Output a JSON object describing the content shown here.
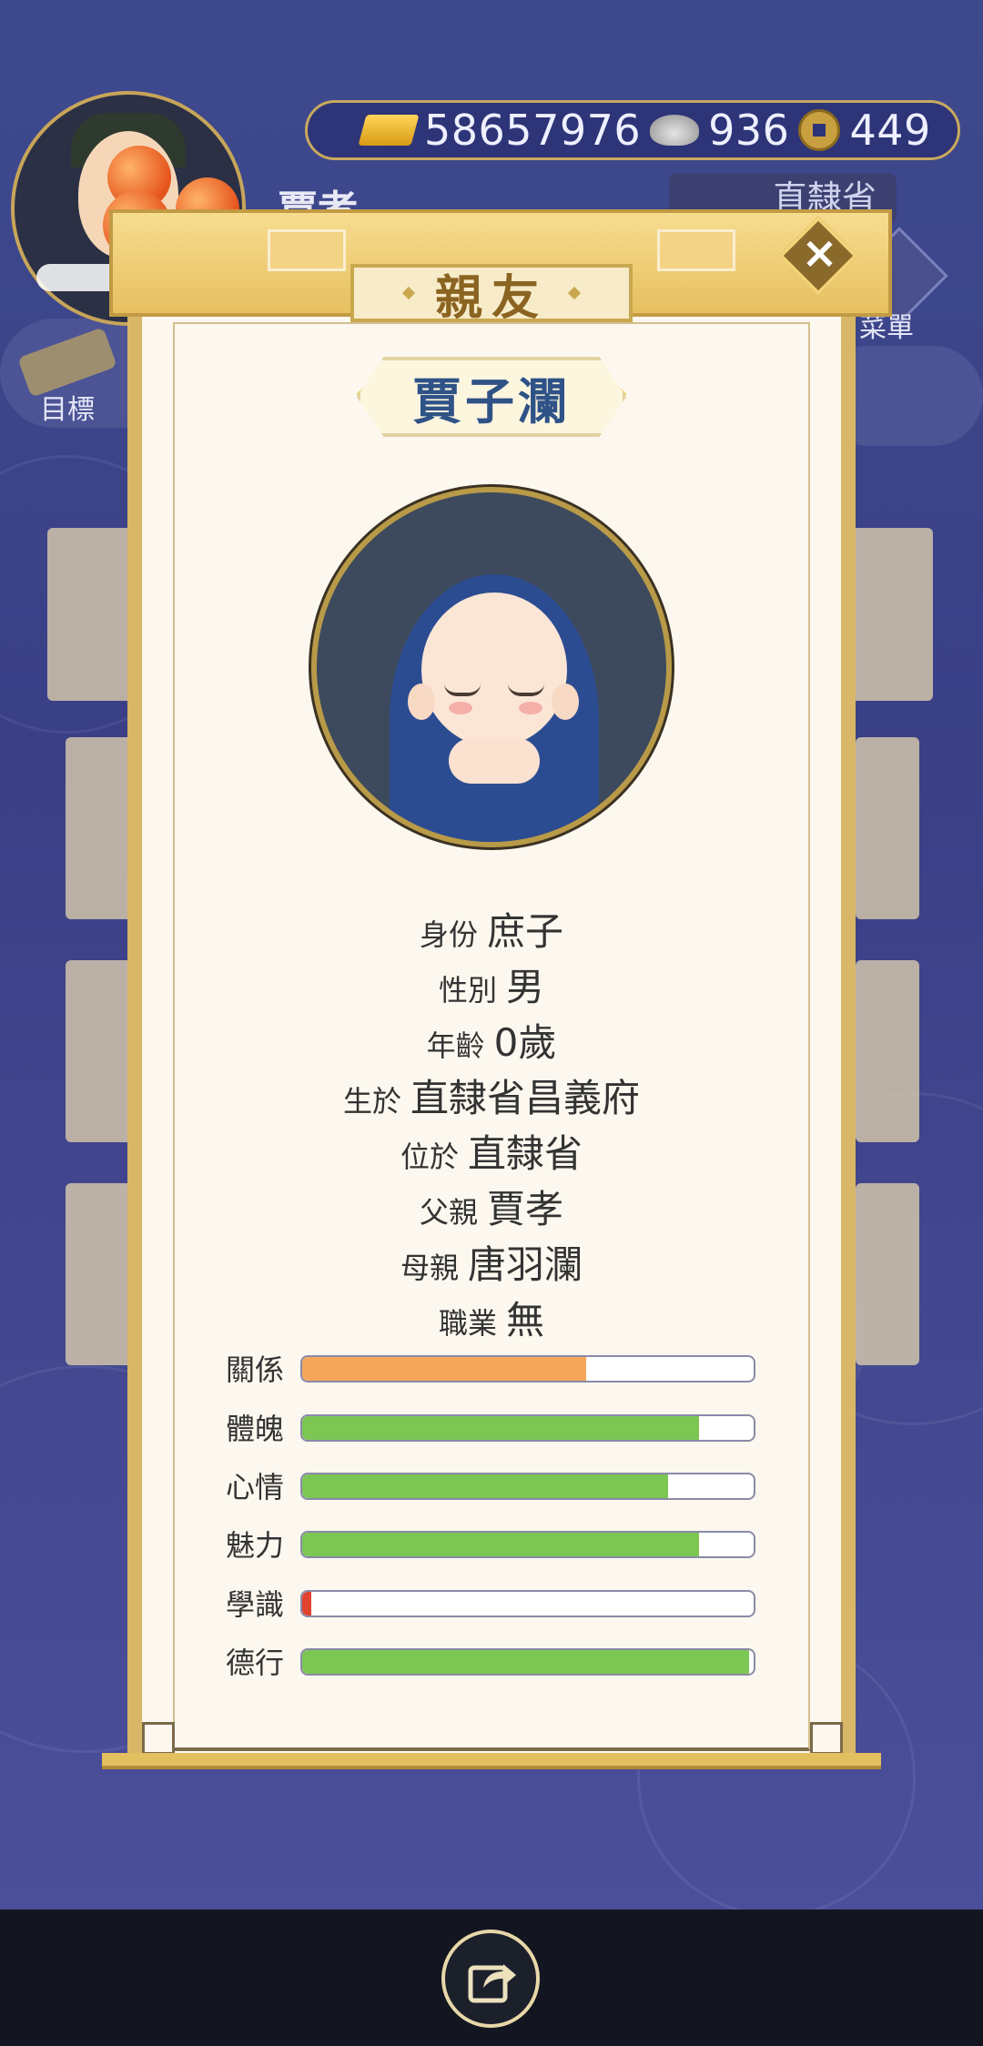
{
  "hud": {
    "player_name": "賈孝",
    "currency": {
      "gold": "58657976",
      "silver": "936",
      "coin": "449"
    },
    "region": "直隸省",
    "menu_label": "菜單",
    "goal_label": "目標"
  },
  "dialog": {
    "title": "親友",
    "child_name": "賈子瀾",
    "info": [
      {
        "label": "身份",
        "value": "庶子"
      },
      {
        "label": "性別",
        "value": "男"
      },
      {
        "label": "年齡",
        "value": "0歲"
      },
      {
        "label": "生於",
        "value": "直隸省昌義府"
      },
      {
        "label": "位於",
        "value": "直隸省"
      },
      {
        "label": "父親",
        "value": "賈孝"
      },
      {
        "label": "母親",
        "value": "唐羽瀾"
      },
      {
        "label": "職業",
        "value": "無"
      }
    ],
    "stats": [
      {
        "label": "關係",
        "fraction": 0.63,
        "color": "#f5a65b"
      },
      {
        "label": "體魄",
        "fraction": 0.88,
        "color": "#7cc653"
      },
      {
        "label": "心情",
        "fraction": 0.81,
        "color": "#7cc653"
      },
      {
        "label": "魅力",
        "fraction": 0.88,
        "color": "#7cc653"
      },
      {
        "label": "學識",
        "fraction": 0.02,
        "color": "#e0442e"
      },
      {
        "label": "德行",
        "fraction": 0.99,
        "color": "#7cc653"
      }
    ]
  },
  "icons": {
    "close": "close-icon",
    "share": "share-icon"
  }
}
